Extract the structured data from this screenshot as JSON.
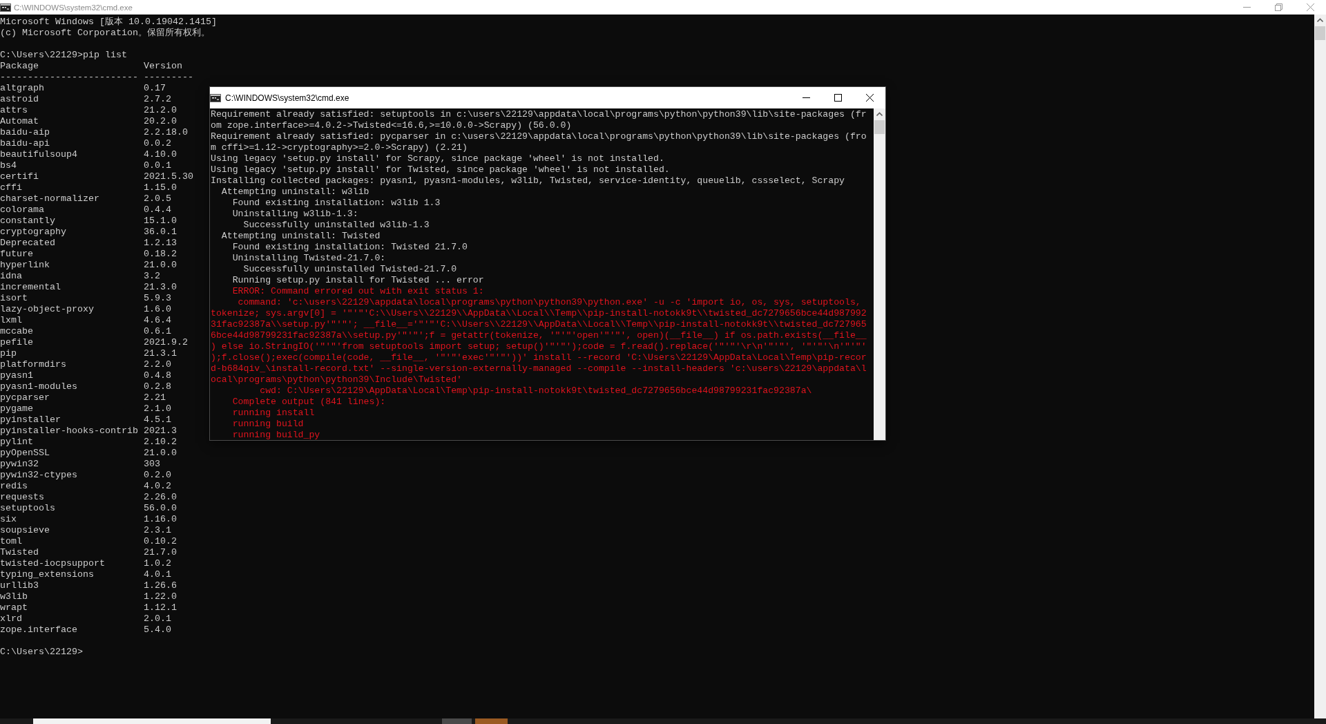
{
  "background_window": {
    "title": "C:\\WINDOWS\\system32\\cmd.exe",
    "active": false,
    "banner": [
      "Microsoft Windows [版本 10.0.19042.1415]",
      "(c) Microsoft Corporation。保留所有权利。"
    ],
    "command": "C:\\Users\\22129>pip list",
    "table": {
      "columns": [
        "Package",
        "Version"
      ],
      "rules": [
        "-------------------------",
        "---------"
      ],
      "rows": [
        [
          "altgraph",
          "0.17"
        ],
        [
          "astroid",
          "2.7.2"
        ],
        [
          "attrs",
          "21.2.0"
        ],
        [
          "Automat",
          "20.2.0"
        ],
        [
          "baidu-aip",
          "2.2.18.0"
        ],
        [
          "baidu-api",
          "0.0.2"
        ],
        [
          "beautifulsoup4",
          "4.10.0"
        ],
        [
          "bs4",
          "0.0.1"
        ],
        [
          "certifi",
          "2021.5.30"
        ],
        [
          "cffi",
          "1.15.0"
        ],
        [
          "charset-normalizer",
          "2.0.5"
        ],
        [
          "colorama",
          "0.4.4"
        ],
        [
          "constantly",
          "15.1.0"
        ],
        [
          "cryptography",
          "36.0.1"
        ],
        [
          "Deprecated",
          "1.2.13"
        ],
        [
          "future",
          "0.18.2"
        ],
        [
          "hyperlink",
          "21.0.0"
        ],
        [
          "idna",
          "3.2"
        ],
        [
          "incremental",
          "21.3.0"
        ],
        [
          "isort",
          "5.9.3"
        ],
        [
          "lazy-object-proxy",
          "1.6.0"
        ],
        [
          "lxml",
          "4.6.4"
        ],
        [
          "mccabe",
          "0.6.1"
        ],
        [
          "pefile",
          "2021.9.2"
        ],
        [
          "pip",
          "21.3.1"
        ],
        [
          "platformdirs",
          "2.2.0"
        ],
        [
          "pyasn1",
          "0.4.8"
        ],
        [
          "pyasn1-modules",
          "0.2.8"
        ],
        [
          "pycparser",
          "2.21"
        ],
        [
          "pygame",
          "2.1.0"
        ],
        [
          "pyinstaller",
          "4.5.1"
        ],
        [
          "pyinstaller-hooks-contrib",
          "2021.3"
        ],
        [
          "pylint",
          "2.10.2"
        ],
        [
          "pyOpenSSL",
          "21.0.0"
        ],
        [
          "pywin32",
          "303"
        ],
        [
          "pywin32-ctypes",
          "0.2.0"
        ],
        [
          "redis",
          "4.0.2"
        ],
        [
          "requests",
          "2.26.0"
        ],
        [
          "setuptools",
          "56.0.0"
        ],
        [
          "six",
          "1.16.0"
        ],
        [
          "soupsieve",
          "2.3.1"
        ],
        [
          "toml",
          "0.10.2"
        ],
        [
          "Twisted",
          "21.7.0"
        ],
        [
          "twisted-iocpsupport",
          "1.0.2"
        ],
        [
          "typing_extensions",
          "4.0.1"
        ],
        [
          "urllib3",
          "1.26.6"
        ],
        [
          "w3lib",
          "1.22.0"
        ],
        [
          "wrapt",
          "1.12.1"
        ],
        [
          "xlrd",
          "2.0.1"
        ],
        [
          "zope.interface",
          "5.4.0"
        ]
      ]
    },
    "prompt": "C:\\Users\\22129>"
  },
  "foreground_window": {
    "title": "C:\\WINDOWS\\system32\\cmd.exe",
    "active": true,
    "lines": [
      {
        "kind": "output",
        "text": "Requirement already satisfied: setuptools in c:\\users\\22129\\appdata\\local\\programs\\python\\python39\\lib\\site-packages (fr"
      },
      {
        "kind": "output",
        "text": "om zope.interface>=4.0.2->Twisted<=16.6,>=10.0.0->Scrapy) (56.0.0)"
      },
      {
        "kind": "output",
        "text": "Requirement already satisfied: pycparser in c:\\users\\22129\\appdata\\local\\programs\\python\\python39\\lib\\site-packages (fro"
      },
      {
        "kind": "output",
        "text": "m cffi>=1.12->cryptography>=2.0->Scrapy) (2.21)"
      },
      {
        "kind": "output",
        "text": "Using legacy 'setup.py install' for Scrapy, since package 'wheel' is not installed."
      },
      {
        "kind": "output",
        "text": "Using legacy 'setup.py install' for Twisted, since package 'wheel' is not installed."
      },
      {
        "kind": "output",
        "text": "Installing collected packages: pyasn1, pyasn1-modules, w3lib, Twisted, service-identity, queuelib, cssselect, Scrapy"
      },
      {
        "kind": "output",
        "text": "  Attempting uninstall: w3lib"
      },
      {
        "kind": "output",
        "text": "    Found existing installation: w3lib 1.3"
      },
      {
        "kind": "output",
        "text": "    Uninstalling w3lib-1.3:"
      },
      {
        "kind": "output",
        "text": "      Successfully uninstalled w3lib-1.3"
      },
      {
        "kind": "output",
        "text": "  Attempting uninstall: Twisted"
      },
      {
        "kind": "output",
        "text": "    Found existing installation: Twisted 21.7.0"
      },
      {
        "kind": "output",
        "text": "    Uninstalling Twisted-21.7.0:"
      },
      {
        "kind": "output",
        "text": "      Successfully uninstalled Twisted-21.7.0"
      },
      {
        "kind": "output",
        "text": "    Running setup.py install for Twisted ... error"
      },
      {
        "kind": "error",
        "text": "    ERROR: Command errored out with exit status 1:"
      },
      {
        "kind": "error",
        "text": "     command: 'c:\\users\\22129\\appdata\\local\\programs\\python\\python39\\python.exe' -u -c 'import io, os, sys, setuptools,"
      },
      {
        "kind": "error",
        "text": "tokenize; sys.argv[0] = '\"'\"'C:\\\\Users\\\\22129\\\\AppData\\\\Local\\\\Temp\\\\pip-install-notokk9t\\\\twisted_dc7279656bce44d987992"
      },
      {
        "kind": "error",
        "text": "31fac92387a\\\\setup.py'\"'\"'; __file__='\"'\"'C:\\\\Users\\\\22129\\\\AppData\\\\Local\\\\Temp\\\\pip-install-notokk9t\\\\twisted_dc727965"
      },
      {
        "kind": "error",
        "text": "6bce44d98799231fac92387a\\\\setup.py'\"'\"';f = getattr(tokenize, '\"'\"'open'\"'\"', open)(__file__) if os.path.exists(__file__"
      },
      {
        "kind": "error",
        "text": ") else io.StringIO('\"'\"'from setuptools import setup; setup()'\"'\"');code = f.read().replace('\"'\"'\\r\\n'\"'\"', '\"'\"'\\n'\"'\"'"
      },
      {
        "kind": "error",
        "text": ");f.close();exec(compile(code, __file__, '\"'\"'exec'\"'\"'))' install --record 'C:\\Users\\22129\\AppData\\Local\\Temp\\pip-recor"
      },
      {
        "kind": "error",
        "text": "d-b684qiv_\\install-record.txt' --single-version-externally-managed --compile --install-headers 'c:\\users\\22129\\appdata\\l"
      },
      {
        "kind": "error",
        "text": "ocal\\programs\\python\\python39\\Include\\Twisted'"
      },
      {
        "kind": "error",
        "text": "         cwd: C:\\Users\\22129\\AppData\\Local\\Temp\\pip-install-notokk9t\\twisted_dc7279656bce44d98799231fac92387a\\"
      },
      {
        "kind": "error",
        "text": "    Complete output (841 lines):"
      },
      {
        "kind": "error",
        "text": "    running install"
      },
      {
        "kind": "error",
        "text": "    running build"
      },
      {
        "kind": "error",
        "text": "    running build_py"
      }
    ]
  }
}
